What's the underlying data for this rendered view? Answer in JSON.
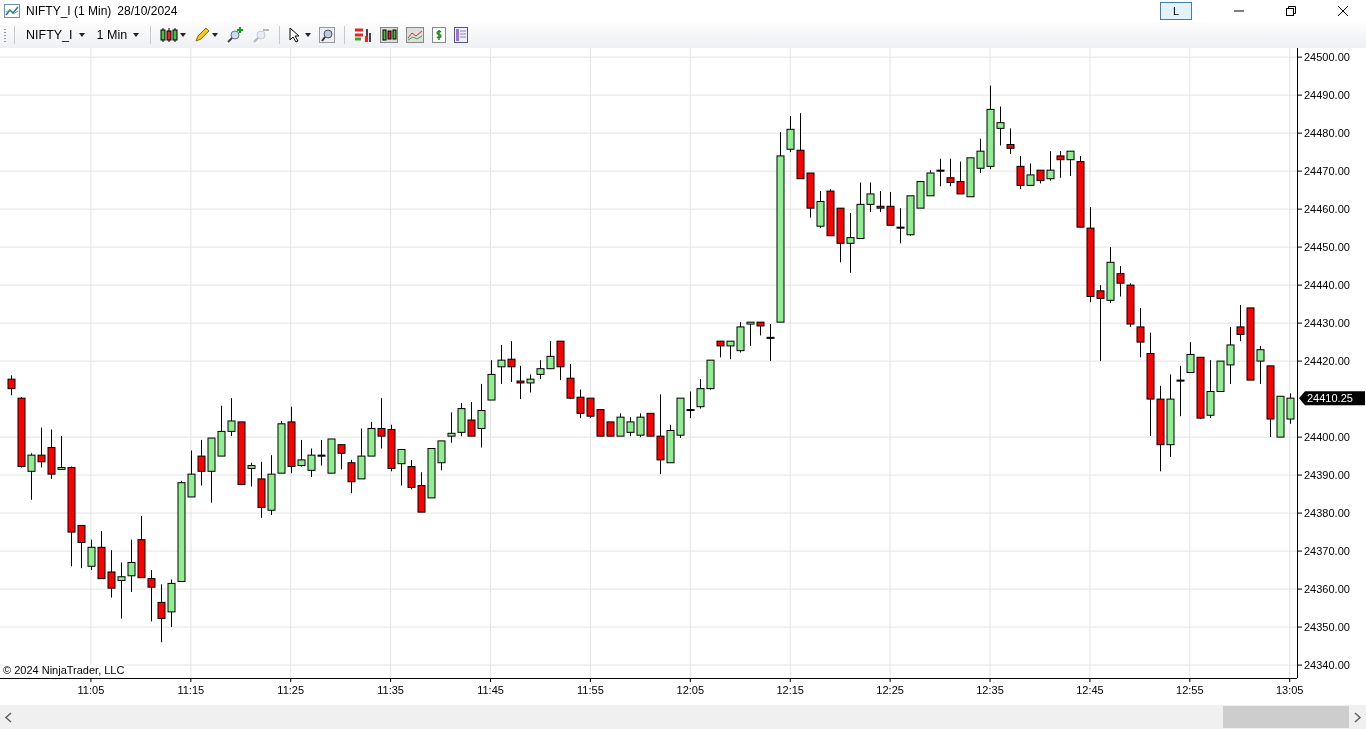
{
  "window": {
    "title": "NIFTY_I (1 Min)",
    "date": "28/10/2024",
    "layout_button": "L"
  },
  "toolbar": {
    "instrument": "NIFTY_I",
    "interval": "1 Min",
    "zoom_out_disabled": true
  },
  "chart": {
    "copyright": "© 2024 NinjaTrader, LLC",
    "last_price": "24410.25",
    "chart_data": {
      "type": "candlestick",
      "grid": true,
      "ylim": [
        24336.6,
        24502.4
      ],
      "categories": [
        null,
        null,
        null,
        null,
        null,
        null,
        null,
        null,
        "11:05",
        null,
        null,
        null,
        null,
        null,
        null,
        null,
        null,
        null,
        "11:15",
        null,
        null,
        null,
        null,
        null,
        null,
        null,
        null,
        null,
        "11:25",
        null,
        null,
        null,
        null,
        null,
        null,
        null,
        null,
        null,
        "11:35",
        null,
        null,
        null,
        null,
        null,
        null,
        null,
        null,
        null,
        "11:45",
        null,
        null,
        null,
        null,
        null,
        null,
        null,
        null,
        null,
        "11:55",
        null,
        null,
        null,
        null,
        null,
        null,
        null,
        null,
        null,
        "12:05",
        null,
        null,
        null,
        null,
        null,
        null,
        null,
        null,
        null,
        "12:15",
        null,
        null,
        null,
        null,
        null,
        null,
        null,
        null,
        null,
        "12:25",
        null,
        null,
        null,
        null,
        null,
        null,
        null,
        null,
        null,
        "12:35",
        null,
        null,
        null,
        null,
        null,
        null,
        null,
        null,
        null,
        "12:45",
        null,
        null,
        null,
        null,
        null,
        null,
        null,
        null,
        null,
        "12:55",
        null,
        null,
        null,
        null,
        null,
        null,
        null,
        null,
        null,
        "13:05"
      ],
      "yticks": [
        {
          "value": 24340,
          "label": "24340.00"
        },
        {
          "value": 24350,
          "label": "24350.00"
        },
        {
          "value": 24360,
          "label": "24360.00"
        },
        {
          "value": 24370,
          "label": "24370.00"
        },
        {
          "value": 24380,
          "label": "24380.00"
        },
        {
          "value": 24390,
          "label": "24390.00"
        },
        {
          "value": 24400,
          "label": "24400.00"
        },
        {
          "value": 24420,
          "label": "24420.00"
        },
        {
          "value": 24430,
          "label": "24430.00"
        },
        {
          "value": 24440,
          "label": "24440.00"
        },
        {
          "value": 24450,
          "label": "24450.00"
        },
        {
          "value": 24460,
          "label": "24460.00"
        },
        {
          "value": 24470,
          "label": "24470.00"
        },
        {
          "value": 24480,
          "label": "24480.00"
        },
        {
          "value": 24490,
          "label": "24490.00"
        },
        {
          "value": 24500,
          "label": "24500.00"
        }
      ],
      "ohlc": [
        [
          24415.25,
          24416.25,
          24411,
          24412.75
        ],
        [
          24410.25,
          24410.5,
          24392,
          24392.25
        ],
        [
          24391,
          24395.75,
          24383.5,
          24395.25
        ],
        [
          24395.25,
          24402.5,
          24392,
          24393.5
        ],
        [
          24397.25,
          24402,
          24389,
          24390.25
        ],
        [
          24391.5,
          24400.25,
          24391.5,
          24392
        ],
        [
          24392,
          24392.25,
          24366,
          24375
        ],
        [
          24376.75,
          24376.75,
          24365.5,
          24372.25
        ],
        [
          24366,
          24373,
          24365,
          24371
        ],
        [
          24371,
          24375.25,
          24362.75,
          24362.75
        ],
        [
          24364.5,
          24370.25,
          24357.75,
          24360.25
        ],
        [
          24362.25,
          24367,
          24352.25,
          24363.25
        ],
        [
          24363.5,
          24373,
          24359.25,
          24367
        ],
        [
          24373,
          24379.25,
          24363,
          24363
        ],
        [
          24362.75,
          24365,
          24351.5,
          24360.5
        ],
        [
          24356.5,
          24361.25,
          24346,
          24352.25
        ],
        [
          24354,
          24362.5,
          24350,
          24361.5
        ],
        [
          24362,
          24388.5,
          24362,
          24388
        ],
        [
          24384.25,
          24396.5,
          24384.25,
          24390.25
        ],
        [
          24395,
          24399.25,
          24387.25,
          24391
        ],
        [
          24391,
          24399.75,
          24382.75,
          24399.75
        ],
        [
          24395,
          24408.25,
          24395,
          24401.5
        ],
        [
          24401.5,
          24410.25,
          24400.25,
          24404.25
        ],
        [
          24404,
          24404,
          24387.5,
          24387.5
        ],
        [
          24391.75,
          24393.25,
          24387,
          24392.5
        ],
        [
          24389,
          24393.5,
          24378.75,
          24381.5
        ],
        [
          24380.75,
          24395.25,
          24379.5,
          24390.25
        ],
        [
          24390.5,
          24404.25,
          24390.5,
          24403.5
        ],
        [
          24404,
          24408,
          24390.5,
          24392.25
        ],
        [
          24392.5,
          24399.25,
          24392.25,
          24394
        ],
        [
          24391.25,
          24397,
          24389.5,
          24395.25
        ],
        [
          24395.25,
          24399.25,
          24392.5,
          24395.25
        ],
        [
          24390.5,
          24399.5,
          24390.5,
          24399.5
        ],
        [
          24398,
          24398,
          24391.5,
          24395.75
        ],
        [
          24393.25,
          24394,
          24385.25,
          24388.25
        ],
        [
          24389,
          24402.25,
          24389,
          24395
        ],
        [
          24395,
          24404,
          24395,
          24402.25
        ],
        [
          24402.25,
          24410.25,
          24397,
          24400.25
        ],
        [
          24402,
          24403.25,
          24391,
          24391.75
        ],
        [
          24393,
          24396.75,
          24387.25,
          24396.75
        ],
        [
          24392.25,
          24394,
          24386.25,
          24386.75
        ],
        [
          24387.25,
          24390.75,
          24380.25,
          24380.25
        ],
        [
          24384,
          24397,
          24384,
          24397
        ],
        [
          24393.25,
          24399,
          24391.25,
          24399
        ],
        [
          24400.25,
          24406.5,
          24398.5,
          24401
        ],
        [
          24401.25,
          24409,
          24400.25,
          24407.5
        ],
        [
          24404.5,
          24409.25,
          24400.25,
          24400.25
        ],
        [
          24402.25,
          24414,
          24397.25,
          24407
        ],
        [
          24409.75,
          24420.25,
          24409.75,
          24416.5
        ],
        [
          24418.5,
          24424.25,
          24414,
          24420.25
        ],
        [
          24420.5,
          24425.25,
          24414.5,
          24418.5
        ],
        [
          24414.75,
          24418.75,
          24410,
          24414.25
        ],
        [
          24414.25,
          24416.5,
          24411.75,
          24415.25
        ],
        [
          24416.5,
          24420.25,
          24415.25,
          24418
        ],
        [
          24418,
          24425.25,
          24418,
          24421.25
        ],
        [
          24425.25,
          24425.25,
          24415,
          24418.5
        ],
        [
          24415.5,
          24419.25,
          24410,
          24410.25
        ],
        [
          24410.5,
          24412.5,
          24405,
          24406.25
        ],
        [
          24410.25,
          24410.25,
          24405,
          24405.5
        ],
        [
          24407.25,
          24407.25,
          24400.25,
          24400.25
        ],
        [
          24404,
          24404,
          24400.25,
          24400.25
        ],
        [
          24400.25,
          24406.25,
          24400.25,
          24405.25
        ],
        [
          24401.25,
          24405.25,
          24400.25,
          24404
        ],
        [
          24400.5,
          24406.25,
          24400,
          24405.25
        ],
        [
          24406.25,
          24406.25,
          24400.25,
          24400.25
        ],
        [
          24400.25,
          24411.25,
          24390.25,
          24394
        ],
        [
          24393.25,
          24403.25,
          24393.25,
          24401.75
        ],
        [
          24400.5,
          24410.25,
          24399.75,
          24410.25
        ],
        [
          24407.25,
          24412,
          24405,
          24407.25
        ],
        [
          24408,
          24415.25,
          24407.5,
          24412.75
        ],
        [
          24412.75,
          24420.25,
          24412.5,
          24420.25
        ],
        [
          24425.25,
          24425.25,
          24421,
          24424
        ],
        [
          24424,
          24425.25,
          24420.5,
          24425.25
        ],
        [
          24422.75,
          24430.25,
          24422.25,
          24429
        ],
        [
          24429.75,
          24430.25,
          24424,
          24430.25
        ],
        [
          24430.25,
          24430.25,
          24426.75,
          24429.25
        ],
        [
          24426.25,
          24429.75,
          24420,
          24426
        ],
        [
          24430.25,
          24480.25,
          24430.25,
          24474
        ],
        [
          24475.75,
          24484.5,
          24475,
          24481
        ],
        [
          24475.5,
          24485.25,
          24468,
          24468
        ],
        [
          24469.5,
          24469.5,
          24457.75,
          24460.25
        ],
        [
          24455.5,
          24464.75,
          24455,
          24462
        ],
        [
          24464.75,
          24465.25,
          24453,
          24453
        ],
        [
          24460.25,
          24460.25,
          24446,
          24451
        ],
        [
          24451,
          24459,
          24443.25,
          24452.5
        ],
        [
          24452.25,
          24467,
          24452.25,
          24461.25
        ],
        [
          24461.25,
          24467,
          24459.25,
          24464
        ],
        [
          24460.75,
          24464.75,
          24459.25,
          24460.25
        ],
        [
          24460.75,
          24464.5,
          24455.75,
          24455.75
        ],
        [
          24455.25,
          24460.25,
          24451,
          24455.25
        ],
        [
          24453.25,
          24463.5,
          24453,
          24463.5
        ],
        [
          24460.25,
          24467.25,
          24460.25,
          24467.25
        ],
        [
          24463.5,
          24470.25,
          24463.5,
          24469.5
        ],
        [
          24470.25,
          24473.25,
          24466,
          24470.25
        ],
        [
          24468.25,
          24473.25,
          24466,
          24467
        ],
        [
          24467.25,
          24472.5,
          24464,
          24464
        ],
        [
          24463.25,
          24473.5,
          24463.25,
          24473.5
        ],
        [
          24470.75,
          24478.5,
          24469.5,
          24475.25
        ],
        [
          24471.25,
          24492.5,
          24470.5,
          24486.25
        ],
        [
          24481.25,
          24487,
          24476.75,
          24482.75
        ],
        [
          24477,
          24481.25,
          24474.5,
          24476
        ],
        [
          24471.25,
          24474,
          24465.25,
          24466.25
        ],
        [
          24466.25,
          24472,
          24466.25,
          24469
        ],
        [
          24470.25,
          24470.25,
          24466.75,
          24467.5
        ],
        [
          24468,
          24475.25,
          24467.5,
          24470.25
        ],
        [
          24474,
          24475.25,
          24468.25,
          24473
        ],
        [
          24473,
          24475.25,
          24468.75,
          24475.25
        ],
        [
          24472.5,
          24474,
          24455.25,
          24455.25
        ],
        [
          24455,
          24460.5,
          24435.5,
          24437
        ],
        [
          24438.5,
          24440,
          24420,
          24436.5
        ],
        [
          24436,
          24450,
          24435.25,
          24446
        ],
        [
          24443,
          24445,
          24437,
          24440.5
        ],
        [
          24440,
          24440.5,
          24429,
          24429.75
        ],
        [
          24429,
          24434,
          24421,
          24425
        ],
        [
          24422,
          24427.5,
          24400.25,
          24410
        ],
        [
          24410,
          24413.5,
          24391,
          24398
        ],
        [
          24398,
          24416.5,
          24394.75,
          24410
        ],
        [
          24415,
          24418.75,
          24405.5,
          24415
        ],
        [
          24417,
          24425,
          24417,
          24421.75
        ],
        [
          24421,
          24421,
          24404.75,
          24405
        ],
        [
          24405.75,
          24420.25,
          24405,
          24412
        ],
        [
          24412,
          24420,
          24412,
          24420
        ],
        [
          24419,
          24429,
          24414,
          24424.25
        ],
        [
          24429,
          24434.75,
          24425.25,
          24427
        ],
        [
          24434,
          24434,
          24415,
          24415
        ],
        [
          24420,
          24424,
          24414,
          24423
        ],
        [
          24418.75,
          24418.75,
          24400,
          24404.75
        ],
        [
          24400,
          24410.75,
          24400,
          24410.75
        ],
        [
          24404.75,
          24411.5,
          24403.5,
          24410.25
        ]
      ]
    }
  }
}
